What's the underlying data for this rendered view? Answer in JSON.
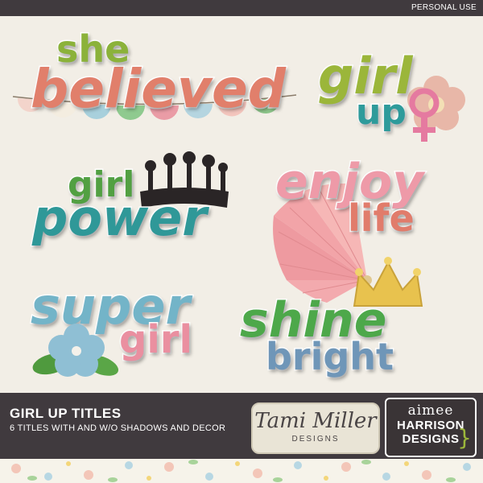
{
  "header": {
    "badge": "PERSONAL USE"
  },
  "titles": {
    "she": "she",
    "believed": "believed",
    "girl_up_1": "girl",
    "girl_up_2": "up",
    "girl_power_1": "girl",
    "girl_power_2": "power",
    "enjoy": "enjoy",
    "life": "life",
    "super": "super",
    "super_girl": "girl",
    "shine": "shine",
    "bright": "bright"
  },
  "footer": {
    "title": "GIRL UP TITLES",
    "subtitle": "6 TITLES WITH AND W/O SHADOWS AND DECOR",
    "tami_name": "Tami Miller",
    "tami_designs": "DESIGNS",
    "aimee_line1": "aimee",
    "aimee_line2": "HARRISON",
    "aimee_line3": "DESIGNS"
  },
  "colors": {
    "bar": "#403a3e",
    "background": "#f2eee6",
    "green": "#8bb23a",
    "coral": "#e17f6b",
    "teal": "#2f9898",
    "pink": "#ee9aa8",
    "blue": "#73b4c8"
  },
  "icons": [
    "female-symbol-icon",
    "crown-silhouette-icon",
    "gold-crown-icon",
    "flower-icon",
    "paper-fan-icon",
    "bunting-banner-icon",
    "blue-flower-icon"
  ]
}
